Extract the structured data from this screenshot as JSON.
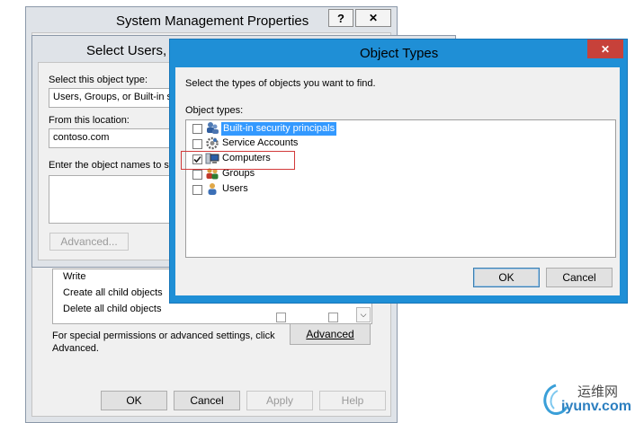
{
  "system_props": {
    "title": "System Management Properties",
    "help_btn": "?",
    "close_btn": "✕",
    "permissions": [
      "Write",
      "Create all child objects",
      "Delete all child objects"
    ],
    "special_text_1": "For special permissions or advanced settings, click",
    "special_text_2": "Advanced.",
    "advanced_button": "Advanced",
    "buttons": {
      "ok": "OK",
      "cancel": "Cancel",
      "apply": "Apply",
      "help": "Help"
    }
  },
  "select_users": {
    "title": "Select Users, C",
    "object_type_label": "Select this object type:",
    "object_type_value": "Users, Groups, or Built-in se",
    "location_label": "From this location:",
    "location_value": "contoso.com",
    "enter_names_label": "Enter the object names to se",
    "advanced_button": "Advanced..."
  },
  "object_types": {
    "title": "Object Types",
    "close_btn": "✕",
    "instruction": "Select the types of objects you want to find.",
    "list_label": "Object types:",
    "items": [
      {
        "label": "Built-in security principals",
        "checked": false,
        "selected": true,
        "icon": "security-principals-icon"
      },
      {
        "label": "Service Accounts",
        "checked": false,
        "selected": false,
        "icon": "service-accounts-icon"
      },
      {
        "label": "Computers",
        "checked": true,
        "selected": false,
        "icon": "computer-icon"
      },
      {
        "label": "Groups",
        "checked": false,
        "selected": false,
        "icon": "groups-icon"
      },
      {
        "label": "Users",
        "checked": false,
        "selected": false,
        "icon": "user-icon"
      }
    ],
    "ok_button": "OK",
    "cancel_button": "Cancel"
  },
  "watermark": {
    "cn_text": "运维网",
    "url_text": "iyunv.com"
  }
}
